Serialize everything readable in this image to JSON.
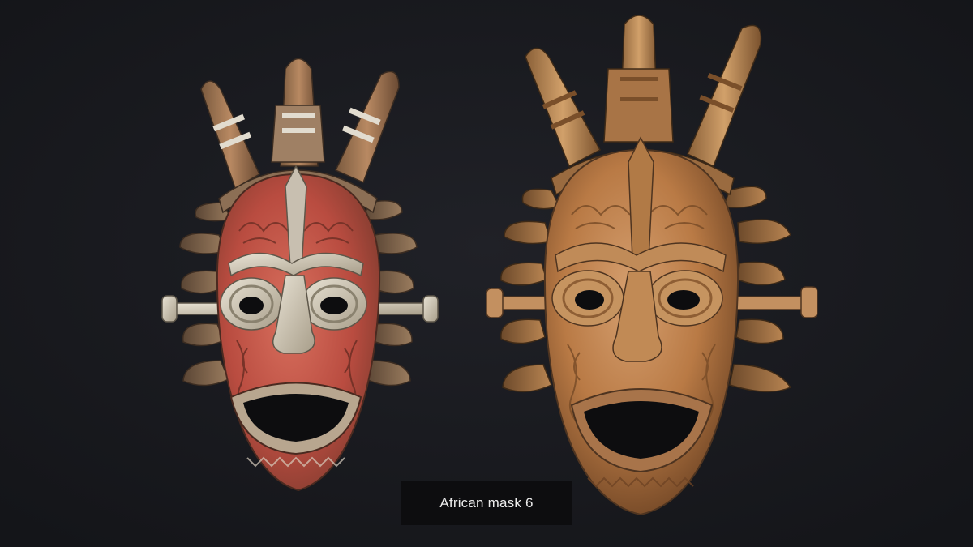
{
  "caption": "African mask 6",
  "colors": {
    "background": "#1a1b1f",
    "caption_background": "#0d0d0f",
    "left_mask_paint": "#c95a4a",
    "left_mask_bone": "#d8d0c0",
    "right_mask_wood": "#c68a55"
  },
  "masks": [
    {
      "name": "red-painted-mask"
    },
    {
      "name": "natural-wood-mask"
    }
  ]
}
